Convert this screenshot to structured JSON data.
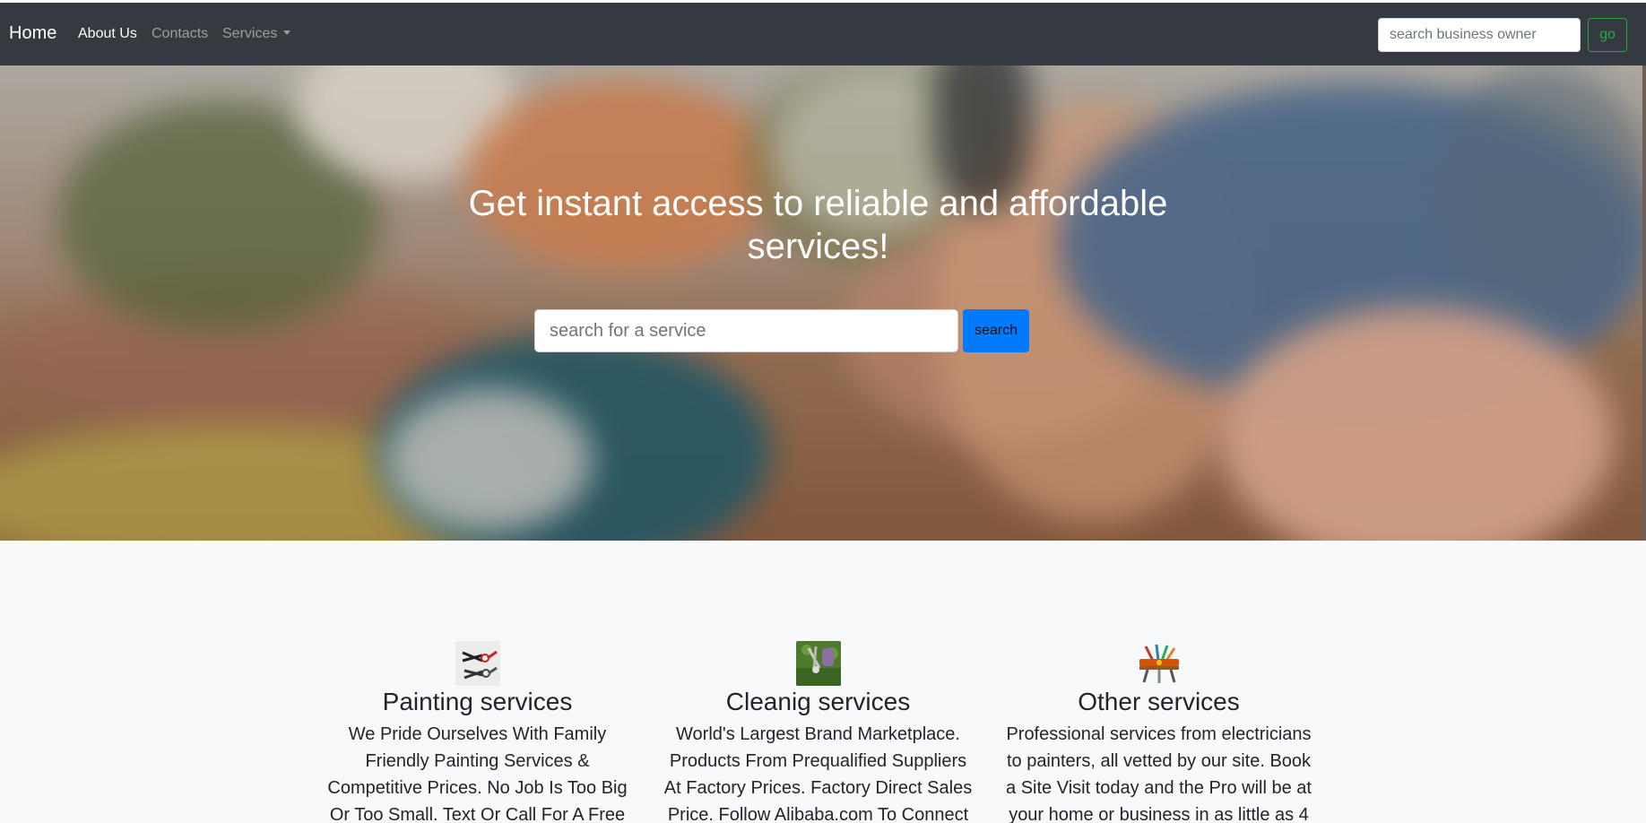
{
  "navbar": {
    "brand": "Home",
    "links": [
      {
        "label": "About Us",
        "active": true
      },
      {
        "label": "Contacts",
        "active": false
      },
      {
        "label": "Services",
        "active": false,
        "dropdown": true
      }
    ],
    "owner_search": {
      "placeholder": "search business owner",
      "value": ""
    },
    "go_label": "go"
  },
  "hero": {
    "title": "Get instant access to reliable and affordable services!",
    "search": {
      "placeholder": "search for a service",
      "value": ""
    },
    "search_label": "search"
  },
  "services": [
    {
      "icon": "pliers-tools-icon",
      "title": "Painting services",
      "text": "We Pride Ourselves With Family Friendly Painting Services & Competitive Prices. No Job Is Too Big Or Too Small. Text Or Call For A Free"
    },
    {
      "icon": "garden-shears-icon",
      "title": "Cleanig services",
      "text": "World's Largest Brand Marketplace. Products From Prequalified Suppliers At Factory Prices. Factory Direct Sales Price. Follow Alibaba.com To Connect"
    },
    {
      "icon": "toolbox-icon",
      "title": "Other services",
      "text": "Professional services from electricians to painters, all vetted by our site. Book a Site Visit today and the Pro will be at your home or business in as little as 4"
    }
  ],
  "colors": {
    "navbar_bg": "#343a40",
    "go_button": "#28a745",
    "search_button": "#007bff",
    "section_bg": "#f8f9fa"
  }
}
